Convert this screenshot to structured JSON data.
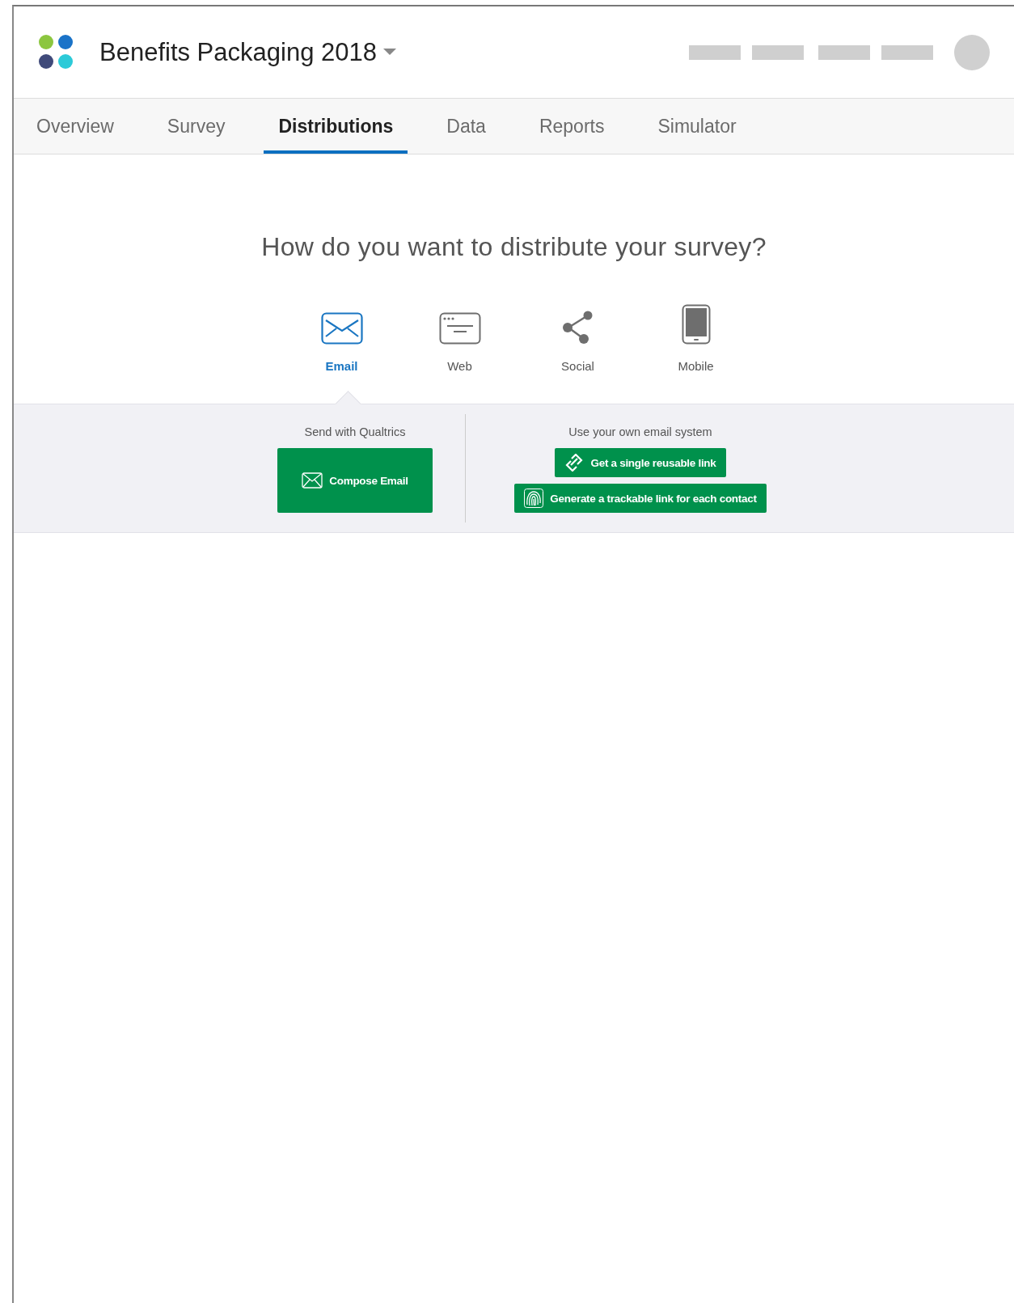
{
  "project": {
    "title": "Benefits Packaging 2018"
  },
  "tabs": [
    {
      "label": "Overview",
      "selected": false
    },
    {
      "label": "Survey",
      "selected": false
    },
    {
      "label": "Distributions",
      "selected": true
    },
    {
      "label": "Data",
      "selected": false
    },
    {
      "label": "Reports",
      "selected": false
    },
    {
      "label": "Simulator",
      "selected": false
    }
  ],
  "heading": "How do you want to distribute your survey?",
  "methods": [
    {
      "kind": "email",
      "label": "Email",
      "selected": true
    },
    {
      "kind": "web",
      "label": "Web",
      "selected": false
    },
    {
      "kind": "social",
      "label": "Social",
      "selected": false
    },
    {
      "kind": "mobile",
      "label": "Mobile",
      "selected": false
    }
  ],
  "panel": {
    "left": {
      "title": "Send with Qualtrics",
      "buttons": [
        {
          "kind": "email",
          "label": "Compose Email"
        }
      ]
    },
    "right": {
      "title": "Use your own email system",
      "buttons": [
        {
          "kind": "link",
          "label": "Get a single reusable link"
        },
        {
          "kind": "fingerprint",
          "label": "Generate a trackable link for each contact"
        }
      ]
    }
  }
}
